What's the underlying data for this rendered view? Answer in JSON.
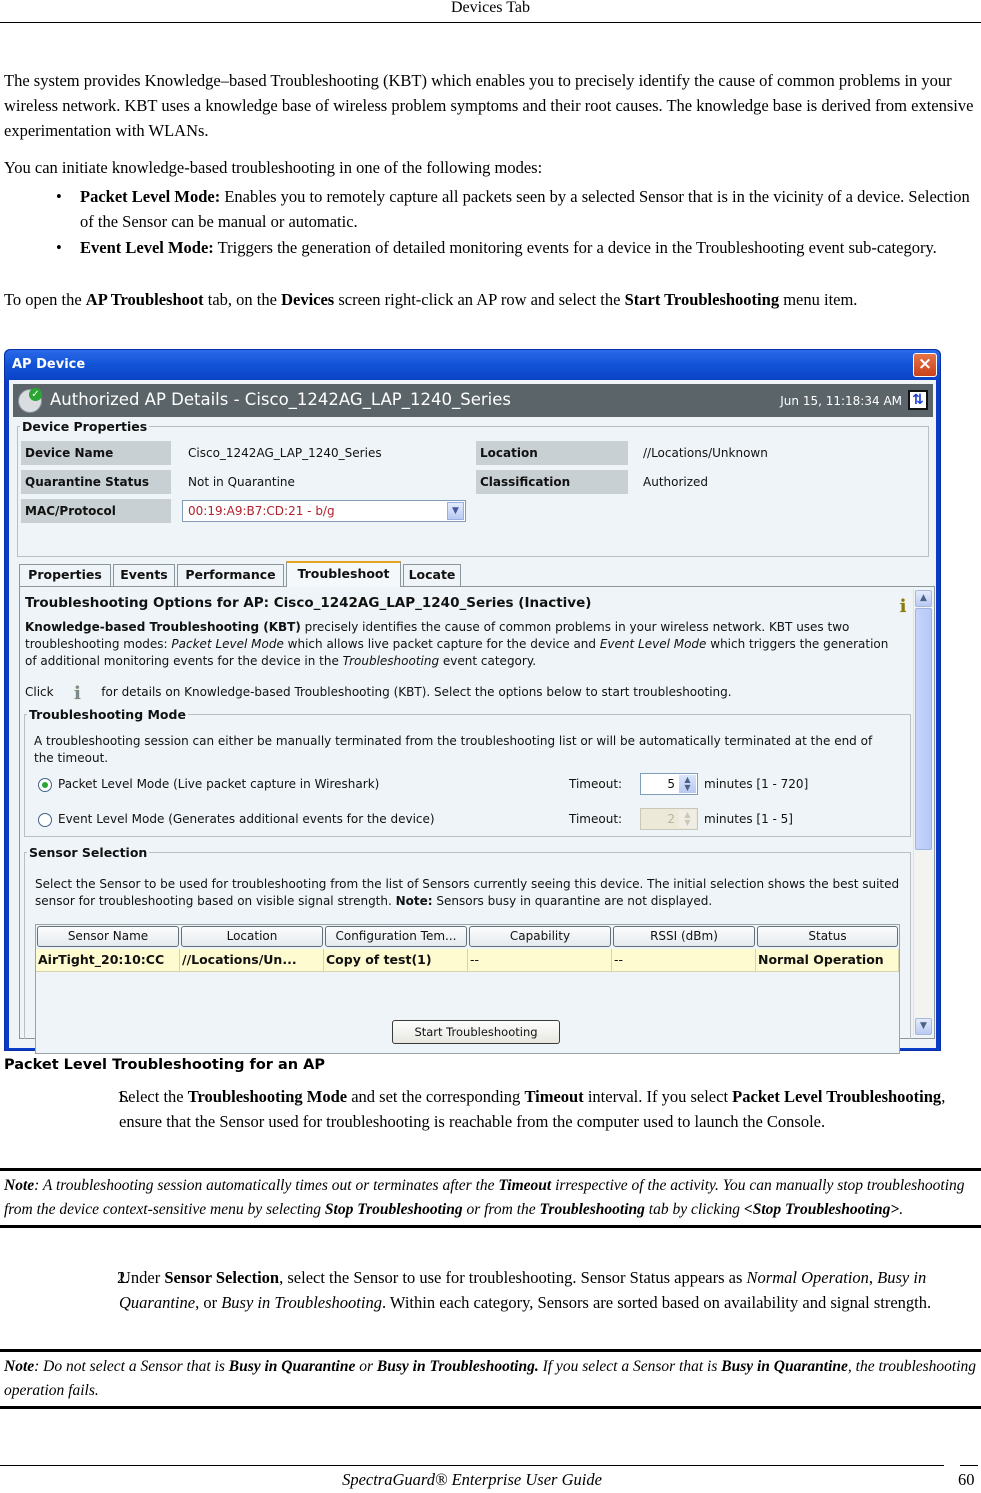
{
  "page_header": "Devices Tab",
  "intro": {
    "para1": "The system provides Knowledge–based Troubleshooting (KBT) which enables you to precisely identify the cause of common problems in your wireless network. KBT uses a knowledge base of wireless problem symptoms and their root causes. The knowledge base is derived from extensive experimentation with WLANs.",
    "para2": "You can initiate knowledge-based troubleshooting in one of the following modes:",
    "bullets": [
      {
        "term": "Packet Level Mode:",
        "text": " Enables you to remotely capture all packets seen by a selected Sensor that is in the vicinity of a device. Selection of the Sensor can be manual or automatic."
      },
      {
        "term": "Event Level Mode:",
        "text": " Triggers the generation of detailed monitoring events for a device in the Troubleshooting event sub-category."
      }
    ],
    "para3": {
      "t1": "To open the ",
      "b1": "AP Troubleshoot",
      "t2": " tab, on the ",
      "b2": "Devices",
      "t3": " screen right-click an AP row and select the ",
      "b3": "Start Troubleshooting",
      "t4": " menu item."
    }
  },
  "window": {
    "title": "AP Device",
    "close_icon": "×",
    "header": {
      "title": "Authorized AP Details -  Cisco_1242AG_LAP_1240_Series",
      "timestamp": "Jun 15, 11:18:34 AM",
      "refresh_icon": "⇅"
    },
    "device_properties": {
      "legend": "Device Properties",
      "fields": [
        {
          "label": "Device Name",
          "value": "Cisco_1242AG_LAP_1240_Series"
        },
        {
          "label": "Location",
          "value": "//Locations/Unknown"
        },
        {
          "label": "Quarantine Status",
          "value": "Not in Quarantine"
        },
        {
          "label": "Classification",
          "value": "Authorized"
        },
        {
          "label": "MAC/Protocol",
          "value": "00:19:A9:B7:CD:21 - b/g"
        }
      ],
      "mac_color": "#b0212a"
    },
    "tabs": [
      {
        "label": "Properties",
        "active": false
      },
      {
        "label": "Events",
        "active": false
      },
      {
        "label": "Performance",
        "active": false
      },
      {
        "label": "Troubleshoot",
        "active": true
      },
      {
        "label": "Locate",
        "active": false
      }
    ],
    "troubleshoot": {
      "title": "Troubleshooting Options for  AP:  Cisco_1242AG_LAP_1240_Series (Inactive)",
      "desc_bold": "Knowledge-based Troubleshooting (KBT)",
      "desc_1": " precisely identifies the cause of common problems in your wireless network. KBT uses two troubleshooting modes: ",
      "desc_i1": "Packet Level Mode",
      "desc_2": " which allows live packet capture for the device and ",
      "desc_i2": "Event Level Mode",
      "desc_3": " which triggers the generation of additional monitoring events for the device in the ",
      "desc_i3": "Troubleshooting",
      "desc_4": " event category.",
      "click_prefix": "Click",
      "click_suffix": "for details on Knowledge-based Troubleshooting (KBT). Select the options below to start troubleshooting.",
      "mode": {
        "legend": "Troubleshooting Mode",
        "desc": "A troubleshooting session can either be manually terminated from the troubleshooting list or will be automatically terminated at the end of the timeout.",
        "options": [
          {
            "label": "Packet Level Mode (Live packet capture in Wireshark)",
            "checked": true,
            "timeout_label": "Timeout:",
            "timeout": "5",
            "unit": "minutes  [1 - 720]",
            "enabled": true
          },
          {
            "label": "Event Level Mode (Generates additional events for the device)",
            "checked": false,
            "timeout_label": "Timeout:",
            "timeout": "2",
            "unit": "minutes  [1 - 5]",
            "enabled": false
          }
        ]
      },
      "sensor": {
        "legend": "Sensor Selection",
        "desc_1": "Select the Sensor to be used for troubleshooting from the list of Sensors currently seeing this device. The initial selection shows the best suited sensor for troubleshooting based on visible signal strength. ",
        "desc_note": "Note:",
        "desc_2": " Sensors busy in quarantine are not displayed.",
        "columns": [
          "Sensor Name",
          "Location",
          "Configuration Tem...",
          "Capability",
          "RSSI (dBm)",
          "Status"
        ],
        "rows": [
          [
            "AirTight_20:10:CC",
            "//Locations/Un...",
            "Copy of  test(1)",
            "--",
            "--",
            "Normal Operation"
          ]
        ]
      },
      "start_button": "Start Troubleshooting"
    }
  },
  "caption": "Packet Level Troubleshooting for an AP",
  "step1": {
    "num": "1.",
    "t1": "Select the ",
    "b1": "Troubleshooting Mode",
    "t2": " and set the corresponding ",
    "b2": "Timeout",
    "t3": " interval. If you select ",
    "b3": "Packet Level Troubleshooting",
    "t4": ", ensure that the Sensor used for troubleshooting is reachable from the computer used to launch the Console."
  },
  "note1": {
    "b0": "Note",
    "t1": ": A troubleshooting session automatically times out or terminates after the ",
    "b1": "Timeout",
    "t2": " irrespective of the activity. You can manually stop troubleshooting from the device context-sensitive menu by selecting ",
    "b2": "Stop Troubleshooting",
    "t3": " or from the ",
    "b3": "Troubleshooting",
    "t4": " tab by clicking ",
    "b4": "<Stop Troubleshooting>",
    "t5": "."
  },
  "step2": {
    "num": "2.",
    "t1": "Under ",
    "b1": "Sensor Selection",
    "t2": ", select the Sensor to use for troubleshooting. Sensor Status appears as ",
    "i1": "Normal Operation",
    "t3": ", ",
    "i2": "Busy in Quarantine",
    "t4": ", or ",
    "i3": "Busy in Troubleshooting",
    "t5": ". Within each category, Sensors are sorted based on availability and signal strength."
  },
  "note2": {
    "b0": "Note",
    "t1": ": Do not select a Sensor that is ",
    "b1": "Busy in Quarantine",
    "t2": " or ",
    "b2": "Busy in Troubleshooting.",
    "t3": " If you select a Sensor that is ",
    "b3": "Busy in Quarantine",
    "t4": ", the troubleshooting operation fails."
  },
  "footer": {
    "title": "SpectraGuard® Enterprise User Guide",
    "page": "60"
  }
}
